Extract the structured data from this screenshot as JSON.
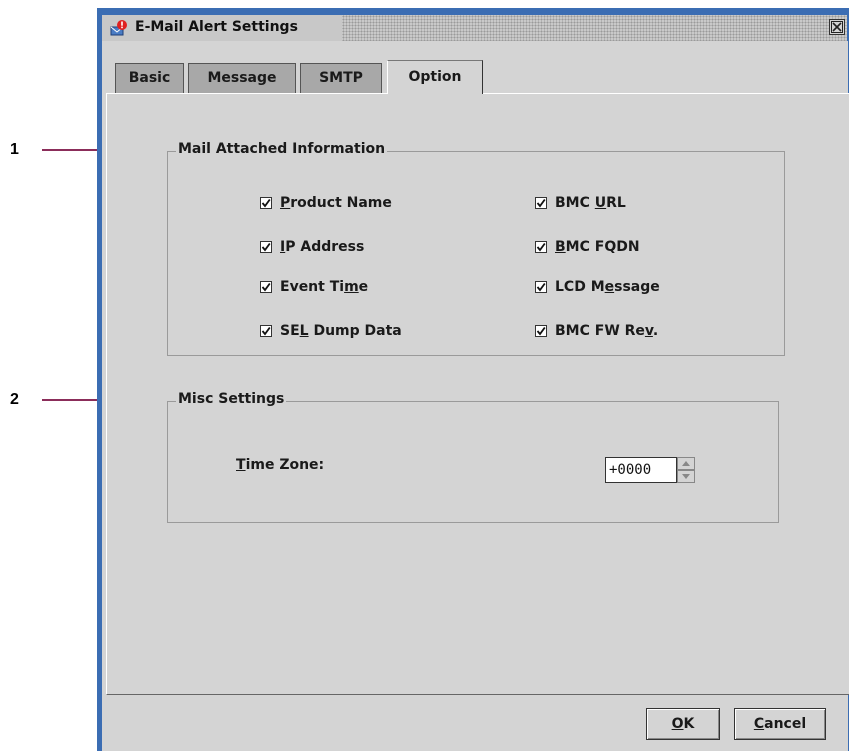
{
  "callouts": [
    {
      "number": "1"
    },
    {
      "number": "2"
    }
  ],
  "window": {
    "title": "E-Mail Alert Settings",
    "icon": "mail-alert-icon",
    "close_icon": "close-icon"
  },
  "tabs": [
    {
      "label": "Basic",
      "active": false
    },
    {
      "label": "Message",
      "active": false
    },
    {
      "label": "SMTP",
      "active": false
    },
    {
      "label": "Option",
      "active": true
    }
  ],
  "mail_attached": {
    "title": "Mail Attached Information",
    "items": [
      {
        "label": "Product Name",
        "mnemonic_index": 0,
        "checked": true
      },
      {
        "label": "BMC URL",
        "mnemonic_index": 4,
        "checked": true
      },
      {
        "label": "IP Address",
        "mnemonic_index": 0,
        "checked": true
      },
      {
        "label": "BMC FQDN",
        "mnemonic_index": 0,
        "checked": true
      },
      {
        "label": "Event Time",
        "mnemonic_index": 8,
        "checked": true
      },
      {
        "label": "LCD Message",
        "mnemonic_index": 5,
        "checked": true
      },
      {
        "label": "SEL Dump Data",
        "mnemonic_index": 2,
        "checked": true
      },
      {
        "label": "BMC FW Rev.",
        "mnemonic_index": 9,
        "checked": true
      }
    ]
  },
  "misc": {
    "title": "Misc Settings",
    "time_zone_label": "Time Zone:",
    "time_zone_mnemonic_index": 0,
    "time_zone_value": "+0000"
  },
  "buttons": {
    "ok": "OK",
    "ok_mnemonic_index": 0,
    "cancel": "Cancel",
    "cancel_mnemonic_index": 0
  },
  "colors": {
    "window_frame": "#3b6db3",
    "panel": "#d4d4d4",
    "callout_line": "#8b2d5a"
  }
}
